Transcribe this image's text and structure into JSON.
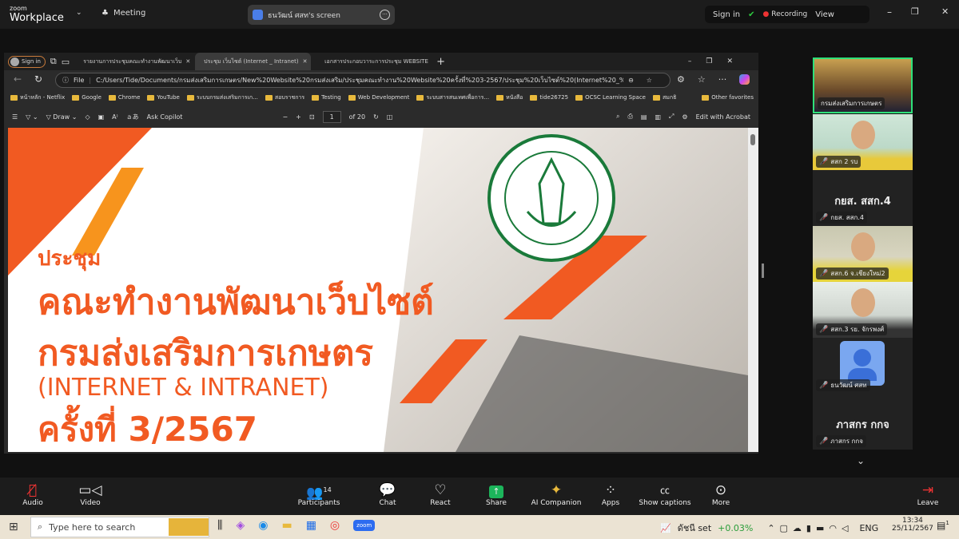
{
  "zoom": {
    "logo_top": "zoom",
    "logo_bottom": "Workplace",
    "meeting_label": "Meeting",
    "share_label": "ธนวัฒน์ ศสท's screen",
    "sign_in": "Sign in",
    "recording": "Recording",
    "view": "View"
  },
  "browser": {
    "sign_in": "Sign in",
    "tabs": [
      {
        "label": "รายงานการประชุมคณะทำงานพัฒนาเว็บ"
      },
      {
        "label": "ประชุม เว็บไซต์ (Internet _ Intranet)"
      },
      {
        "label": "เอกสารประกอบวาระการประชุม WEBSITE"
      }
    ],
    "address_prefix": "File",
    "address": "C:/Users/Tide/Documents/กรมส่งเสริมการเกษตร/New%20Website%20กรมส่งเสริม/ประชุมคณะทำงาน%20Website%20ครั้งที่%203-2567/ประชุม%20เว็บไซต์%20(Internet%20_%20Intran...",
    "bookmarks": [
      "หน้าหลัก - Netflix",
      "Google",
      "Chrome",
      "YouTube",
      "ระบบกรมส่งเสริมการเก...",
      "สอบราชการ",
      "Testing",
      "Web Development",
      "ระบบสารสนเทศเพื่อการ...",
      "หนังสือ",
      "tide26725",
      "OCSC Learning Space",
      "สมกธิ"
    ],
    "other_favorites": "Other favorites",
    "pdf": {
      "draw": "Draw",
      "ask_copilot": "Ask Copilot",
      "page": "1",
      "of_pages": "of 20",
      "edit_acrobat": "Edit with Acrobat"
    }
  },
  "slide": {
    "line1": "ประชุม",
    "line2": "คณะทำงานพัฒนาเว็บไซต์",
    "line3": "กรมส่งเสริมการเกษตร",
    "line4": "(INTERNET & INTRANET)",
    "line5": "ครั้งที่ 3/2567",
    "emblem_text": "กรมส่งเสริมการเกษตร",
    "accent": "#f15a22",
    "emblem_color": "#1a7a3a"
  },
  "participants": [
    {
      "name": "กรมส่งเสริมการเกษตร",
      "video": true,
      "active": true
    },
    {
      "name": "สสก 2 รบ",
      "video": true
    },
    {
      "name": "กยส. สสก.4",
      "big": "กยส. สสก.4"
    },
    {
      "name": "สสก.6 จ.เชียงใหม่2",
      "video": true
    },
    {
      "name": "สสก.3 รย. จักรพงศ์",
      "video": true
    },
    {
      "name": "ธนวัฒน์ ศสท",
      "avatar": true
    },
    {
      "name": "ภาสกร กกจ",
      "big": "ภาสกร กกจ"
    }
  ],
  "toolbar": {
    "audio": "Audio",
    "video": "Video",
    "participants": "Participants",
    "participants_count": "14",
    "chat": "Chat",
    "react": "React",
    "share": "Share",
    "ai": "AI Companion",
    "apps": "Apps",
    "captions": "Show captions",
    "more": "More",
    "leave": "Leave"
  },
  "taskbar": {
    "search_placeholder": "Type here to search",
    "stock_name": "ดัชนี set",
    "stock_change": "+0.03%",
    "lang": "ENG",
    "time": "13:34",
    "date": "25/11/2567",
    "notif": "1"
  }
}
